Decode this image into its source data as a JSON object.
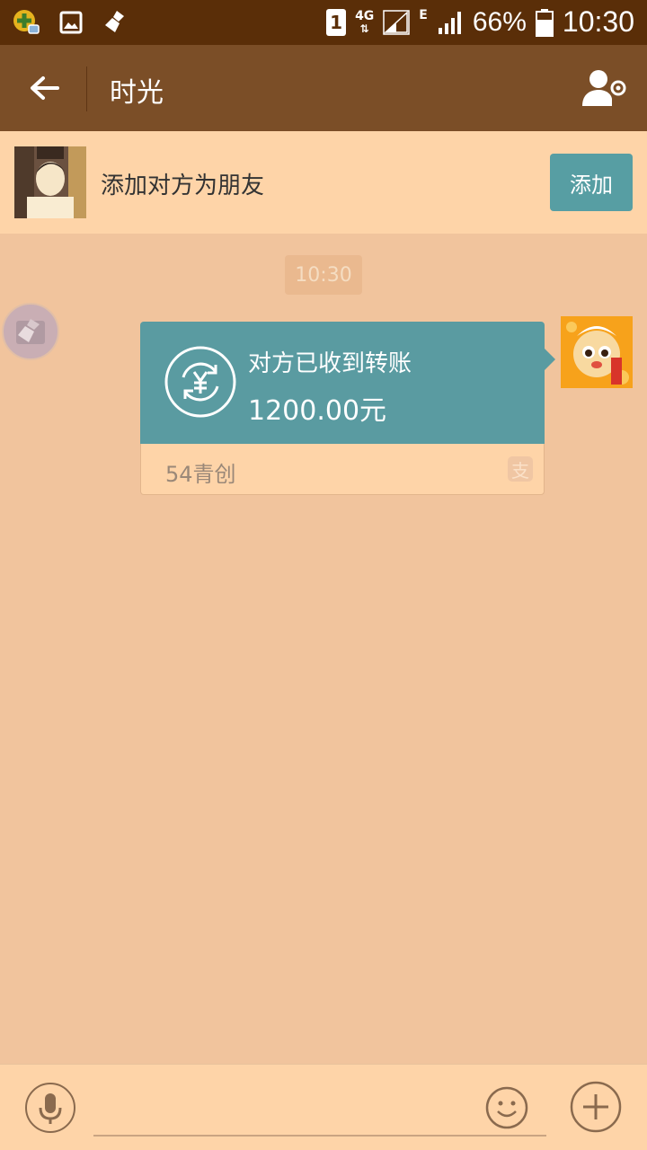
{
  "status_bar": {
    "sim_slot": "1",
    "network_type": "4G",
    "network_secondary": "E",
    "battery_percent": "66%",
    "time": "10:30",
    "icons": [
      "app-notification-icon",
      "image-icon",
      "broom-icon",
      "sim-icon",
      "signal-icon",
      "battery-icon"
    ]
  },
  "header": {
    "title": "时光",
    "back_icon": "arrow-left-icon",
    "profile_icon": "user-settings-icon"
  },
  "add_friend": {
    "text": "添加对方为朋友",
    "button_label": "添加"
  },
  "chat": {
    "timestamp": "10:30",
    "transfer_card": {
      "status": "对方已收到转账",
      "amount": "1200.00元",
      "source": "54青创",
      "icon": "currency-exchange-icon",
      "brand_icon": "alipay-icon",
      "brand_glyph": "支"
    }
  },
  "input_bar": {
    "voice_icon": "microphone-icon",
    "emoji_icon": "smiley-icon",
    "more_icon": "plus-icon"
  },
  "colors": {
    "status_bar": "#5a2e08",
    "top_bar": "#7b4e27",
    "background": "#f1c49d",
    "panel": "#fed4a8",
    "accent": "#579ea3"
  }
}
